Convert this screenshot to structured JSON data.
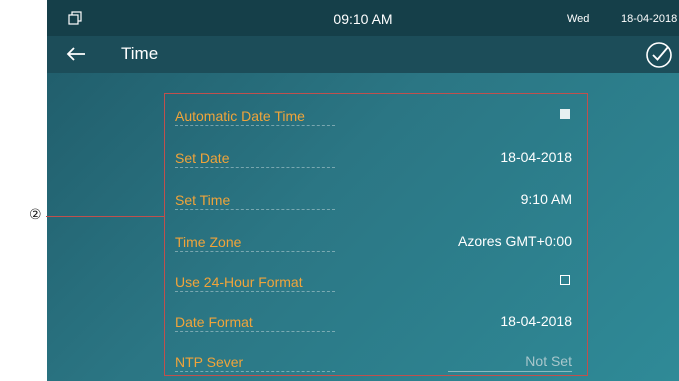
{
  "status_bar": {
    "time": "09:10 AM",
    "day": "Wed",
    "date": "18-04-2018",
    "window_icon": "restore-window-icon"
  },
  "header": {
    "title": "Time",
    "back_icon": "arrow-left-icon",
    "confirm_icon": "check-circle-icon"
  },
  "settings": [
    {
      "label": "Automatic Date Time",
      "type": "checkbox",
      "checked": true
    },
    {
      "label": "Set Date",
      "type": "value",
      "value": "18-04-2018"
    },
    {
      "label": "Set Time",
      "type": "value",
      "value": "9:10 AM"
    },
    {
      "label": "Time Zone",
      "type": "value",
      "value": "Azores GMT+0:00"
    },
    {
      "label": "Use 24-Hour Format",
      "type": "checkbox",
      "checked": false
    },
    {
      "label": "Date Format",
      "type": "value",
      "value": "18-04-2018"
    },
    {
      "label": "NTP Sever",
      "type": "input",
      "placeholder": "Not Set"
    }
  ],
  "annotation": {
    "marker": "②"
  },
  "colors": {
    "label": "#f0a43a",
    "status_bar": "#153f49",
    "title_bar": "#1c4d59",
    "annotation": "#c0504d"
  }
}
